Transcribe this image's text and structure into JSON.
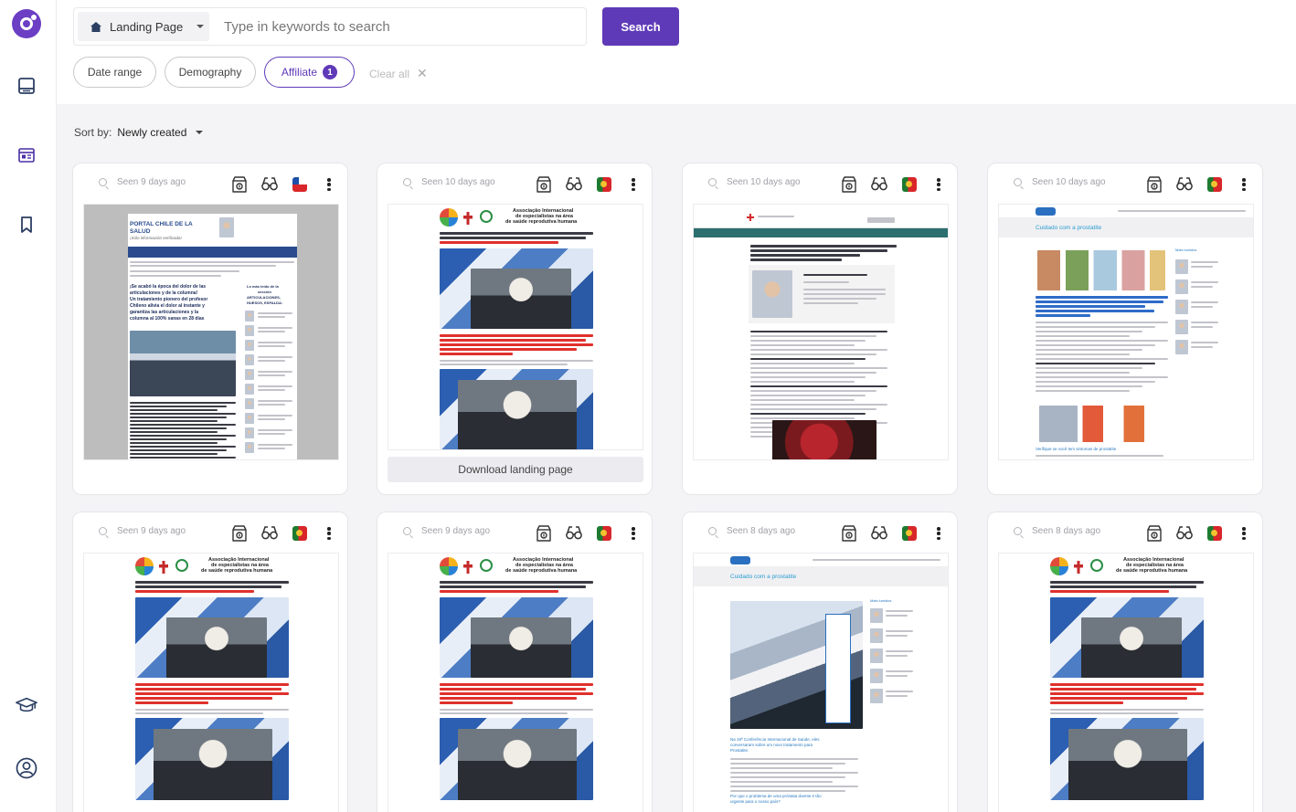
{
  "search": {
    "type_label": "Landing Page",
    "placeholder": "Type in keywords to search",
    "value": "",
    "button_label": "Search"
  },
  "filters": [
    {
      "label": "Date range"
    },
    {
      "label": "Demography"
    },
    {
      "label": "Affiliate",
      "count": "1"
    }
  ],
  "clear_label": "Clear all",
  "sort": {
    "label": "Sort by:",
    "value": "Newly created"
  },
  "download_label": "Download landing page",
  "cards": [
    {
      "seen": "Seen 9 days ago",
      "flag": "chile",
      "template": "chile"
    },
    {
      "seen": "Seen 10 days ago",
      "flag": "portugal",
      "template": "assoc"
    },
    {
      "seen": "Seen 10 days ago",
      "flag": "portugal",
      "template": "oncology"
    },
    {
      "seen": "Seen 10 days ago",
      "flag": "portugal",
      "template": "prostate"
    },
    {
      "seen": "Seen 9 days ago",
      "flag": "portugal",
      "template": "assoc"
    },
    {
      "seen": "Seen 9 days ago",
      "flag": "portugal",
      "template": "assoc"
    },
    {
      "seen": "Seen 8 days ago",
      "flag": "portugal",
      "template": "prostate2"
    },
    {
      "seen": "Seen 8 days ago",
      "flag": "portugal",
      "template": "assoc"
    }
  ],
  "thumbnail_text": {
    "chile_title_1": "PORTAL CHILE DE LA",
    "chile_title_2": "SALUD",
    "chile_subtitle": "¡Sólo información verificada!",
    "chile_headline_1": "¡Se acabó la época del dolor de las",
    "chile_headline_2": "articulaciones y de la columna!",
    "chile_headline_3": "Un tratamiento pionero del profesor",
    "chile_headline_4": "Chileno alivia el dolor al instante y",
    "chile_headline_5": "garantiza las articulaciones y la",
    "chile_headline_6": "columna al 100% sanas en 28 días",
    "chile_side_1": "Lo más leído de la",
    "chile_side_2": "sección",
    "chile_side_3": "ARTICULACIONES,",
    "chile_side_4": "HUESOS, ESPALDA:",
    "assoc_title_1": "Associação Internacional",
    "assoc_title_2": "de especialistas na área",
    "assoc_title_3": "de saúde reprodutiva humana",
    "prostate_heading": "Cuidado com a prostatite",
    "prostate_more": "Mais lumidos",
    "prostate_cta": "Verifique se você tem sintomas de prostatite",
    "prostate2_caption_1": "Na 18ª Conferência Internacional de Saúde, eles",
    "prostate2_caption_2": "conversaram sobre um novo tratamento para",
    "prostate2_caption_3": "Prostatite.",
    "prostate2_q_1": "Por que o problema de uma próstata doente é tão",
    "prostate2_q_2": "urgente para o nosso país?"
  },
  "colors": {
    "accent": "#5f3ab8",
    "chip_border": "#c9c9ce",
    "card_border": "#e6e6ea"
  }
}
